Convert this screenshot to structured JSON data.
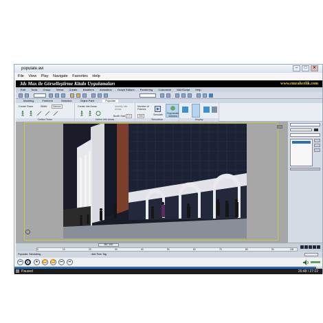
{
  "window": {
    "title": "populate.avi",
    "controls": [
      "–",
      "□",
      "✕"
    ]
  },
  "menu": [
    "File",
    "View",
    "Play",
    "Navigate",
    "Favorites",
    "Help"
  ],
  "banner": {
    "left": "3ds Max ile Görselleştirme Kitabı Uygulamaları",
    "right": "www.emrahcelik.com"
  },
  "max_menu": [
    "Edit",
    "Tools",
    "Group",
    "Views",
    "Create",
    "Modifiers",
    "Animation",
    "Graph Editors",
    "Rendering",
    "Customize",
    "MAXScript",
    "Help"
  ],
  "ribbon_tabs": [
    "Modeling",
    "Freeform",
    "Selection",
    "Object Paint",
    "Populate"
  ],
  "ribbon_active_tab": "Populate",
  "ribbon": {
    "create_flows": "Create Flows",
    "width": "Width:",
    "width_value": "Narrow",
    "create_idle_areas": "Create Idle Areas",
    "identify_idle_areas": "Identify Idle Areas",
    "booth_size": "Booth Size:",
    "booth_size_value": "2.0",
    "number_of_frames": "Number of Frames:",
    "frames_value": "300",
    "simulate": "Simulate",
    "regenerate": "Regenerate Selected",
    "groups": [
      "Define Flows",
      "Define Idle Areas",
      "Simulation",
      "Display"
    ]
  },
  "timeline": {
    "slider": "85 / 100",
    "ticks": [
      "0",
      "10",
      "20",
      "30",
      "40",
      "50",
      "60",
      "70",
      "80",
      "90",
      "100"
    ]
  },
  "statusbar": {
    "left": "Populate: Simulating...",
    "right": "Add Time Tag"
  },
  "player": {
    "status": "Paused",
    "time": "26:48 / 27:22",
    "progress": 0.98,
    "buttons": [
      "⏮",
      "⏵",
      "⏹",
      "⏪",
      "⏩",
      "⏭",
      "⏯"
    ]
  },
  "colors": {
    "banner_bg": "#000000",
    "banner_url": "#f2d23a",
    "viewport": "#a7a7a7",
    "active_border": "#c7c84a"
  }
}
